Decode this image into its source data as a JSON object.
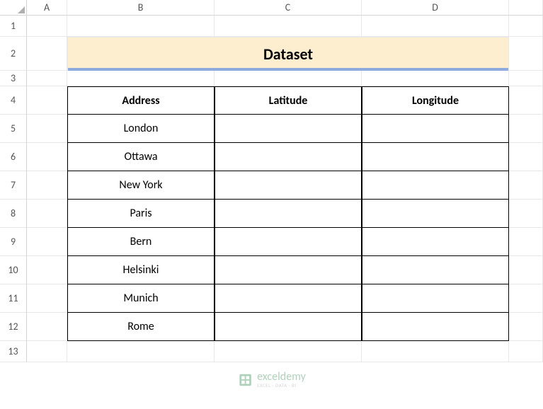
{
  "columns": [
    "A",
    "B",
    "C",
    "D"
  ],
  "rows": [
    "1",
    "2",
    "3",
    "4",
    "5",
    "6",
    "7",
    "8",
    "9",
    "10",
    "11",
    "12",
    "13"
  ],
  "title": "Dataset",
  "headers": {
    "address": "Address",
    "latitude": "Latitude",
    "longitude": "Longitude"
  },
  "data": [
    {
      "address": "London",
      "latitude": "",
      "longitude": ""
    },
    {
      "address": "Ottawa",
      "latitude": "",
      "longitude": ""
    },
    {
      "address": "New York",
      "latitude": "",
      "longitude": ""
    },
    {
      "address": "Paris",
      "latitude": "",
      "longitude": ""
    },
    {
      "address": "Bern",
      "latitude": "",
      "longitude": ""
    },
    {
      "address": "Helsinki",
      "latitude": "",
      "longitude": ""
    },
    {
      "address": "Munich",
      "latitude": "",
      "longitude": ""
    },
    {
      "address": "Rome",
      "latitude": "",
      "longitude": ""
    }
  ],
  "watermark": {
    "main": "exceldemy",
    "sub": "EXCEL · DATA · BI"
  },
  "colors": {
    "title_bg": "#fdeecf",
    "title_underline": "#8faadc"
  }
}
